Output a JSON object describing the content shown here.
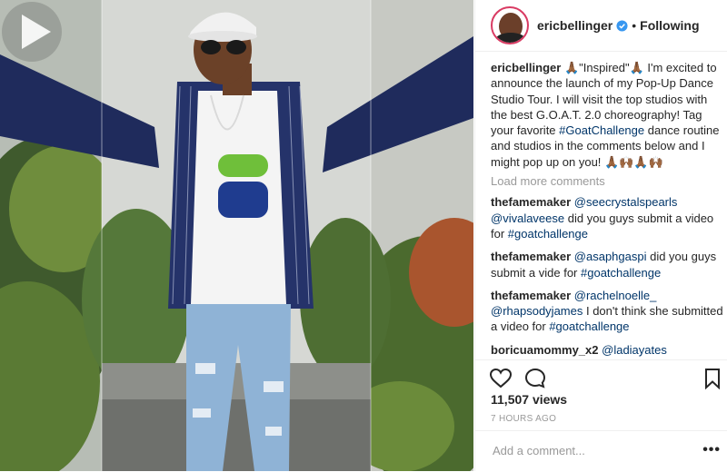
{
  "header": {
    "username": "ericbellinger",
    "separator": "•",
    "follow_state": "Following"
  },
  "caption": {
    "username": "ericbellinger",
    "text_part1": "🙏🏾\"Inspired\"🙏🏾 I'm excited to announce the launch of my Pop-Up Dance Studio Tour. I will visit the top studios with the best G.O.A.T. 2.0 choreography! Tag your favorite ",
    "hashtag": "#GoatChallenge",
    "text_part2": " dance routine and studios in the comments below and I might pop up on you! 🙏🏾🙌🏾🙏🏾🙌🏾"
  },
  "load_more": "Load more comments",
  "comments": [
    {
      "user": "thefamemaker",
      "mention": "@seecrystalspearls",
      "mention2": "@vivalaveese",
      "text": " did you guys submit a video for ",
      "tag": "#goatchallenge"
    },
    {
      "user": "thefamemaker",
      "mention": "@asaphgaspi",
      "text": " did you guys submit a vide for ",
      "tag": "#goatchallenge"
    },
    {
      "user": "thefamemaker",
      "mention": "@rachelnoelle_",
      "mention2": "@rhapsodyjames",
      "text": " I don't think she submitted a video for ",
      "tag": "#goatchallenge"
    },
    {
      "user": "boricuamommy_x2",
      "mention": "@ladiayates"
    }
  ],
  "stats": {
    "views": "11,507 views",
    "time": "7 HOURS AGO"
  },
  "add_comment": {
    "placeholder": "Add a comment...",
    "more_label": "•••"
  },
  "icons": {
    "like": "heart-icon",
    "comment": "comment-bubble-icon",
    "save": "bookmark-icon",
    "play": "play-icon",
    "verified": "verified-badge-icon"
  },
  "colors": {
    "link": "#003569",
    "verified": "#3897f0",
    "muted": "#999999",
    "avatar_ring": "#d93b63"
  }
}
